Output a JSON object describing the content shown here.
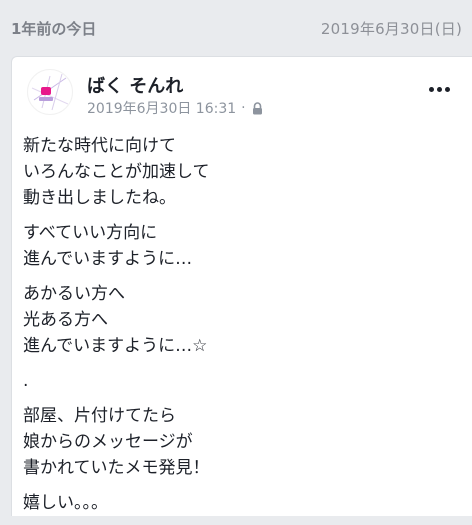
{
  "memory": {
    "title": "1年前の今日",
    "date": "2019年6月30日(日)"
  },
  "post": {
    "author": "ばく そんれ",
    "timestamp": "2019年6月30日 16:31",
    "separator": "·",
    "privacy_icon": "lock-icon",
    "more_icon": "more-horizontal-icon",
    "paragraphs": [
      "新たな時代に向けて\nいろんなことが加速して\n動き出しましたね。",
      "すべていい方向に\n進んでいますように…",
      "あかるい方へ\n光ある方へ\n進んでいますように…☆",
      ".",
      "部屋、片付けてたら\n娘からのメッセージが\n書かれていたメモ発見！",
      "嬉しい。。。"
    ]
  },
  "colors": {
    "background": "#e9ebee",
    "card": "#ffffff",
    "text": "#1d2129",
    "meta": "#8d949e",
    "avatar_accent": "#e8198b"
  }
}
